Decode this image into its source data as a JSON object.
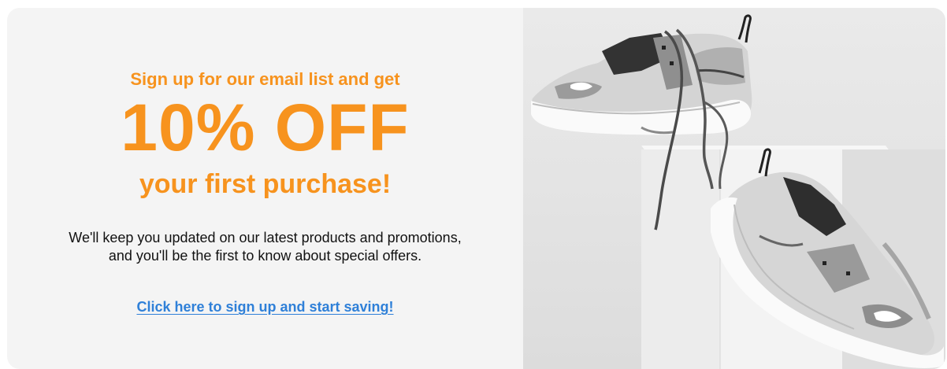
{
  "promo": {
    "kicker": "Sign up for our email list and get",
    "headline": "10% OFF",
    "subhead": "your first purchase!",
    "description_line1": "We'll keep you updated on our latest products and promotions,",
    "description_line2": "and you'll be the first to know about special offers.",
    "cta_label": "Click here to sign up and start saving!"
  },
  "colors": {
    "accent": "#f7931e",
    "link": "#2f80d8",
    "panel_background": "#f4f4f4",
    "body_text": "#111111"
  },
  "image": {
    "subject": "sneakers-on-white-box-photo"
  }
}
